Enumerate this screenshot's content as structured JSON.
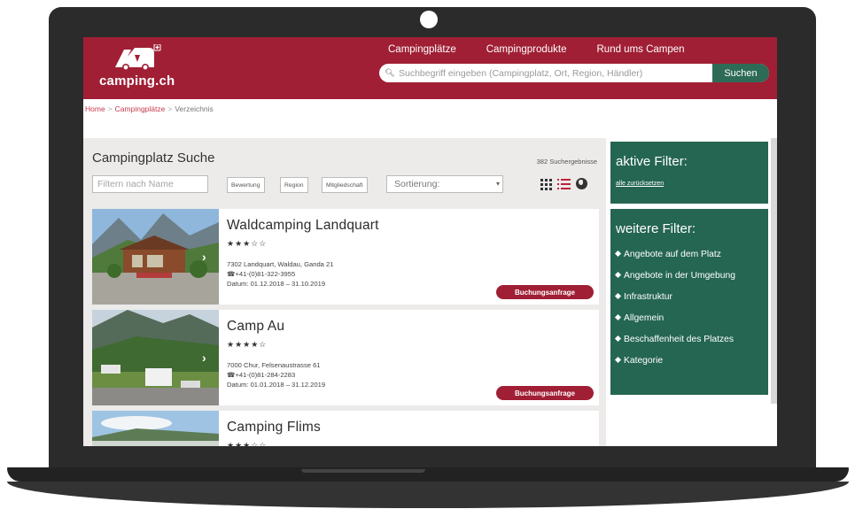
{
  "header": {
    "logo_text": "camping.ch",
    "nav": [
      "Campingplätze",
      "Campingprodukte",
      "Rund ums Campen"
    ],
    "search_placeholder": "Suchbegriff eingeben (Campingplatz, Ort, Region, Händler)",
    "search_button": "Suchen"
  },
  "breadcrumb": [
    "Home",
    "Campingplätze",
    "Verzeichnis"
  ],
  "main": {
    "title": "Campingplatz Suche",
    "result_count": "382 Suchergebnisse",
    "filter_placeholder": "Filtern nach Name",
    "filter_buttons": [
      "Bewertung",
      "Region",
      "Mitgliedschaft"
    ],
    "sort_label": "Sortierung:"
  },
  "results": [
    {
      "name": "Waldcamping Landquart",
      "stars": "★★★☆☆",
      "address": "7302 Landquart, Waldau, Ganda 21",
      "phone": "☎+41-(0)81-322-3955",
      "date": "Datum: 01.12.2018 – 31.10.2019",
      "booking": "Buchungsanfrage"
    },
    {
      "name": "Camp Au",
      "stars": "★★★★☆",
      "address": "7000 Chur, Felsenaustrasse 61",
      "phone": "☎+41-(0)81-284-2283",
      "date": "Datum: 01.01.2018 – 31.12.2019",
      "booking": "Buchungsanfrage"
    },
    {
      "name": "Camping Flims",
      "stars": "★★★☆☆",
      "address": "",
      "phone": "",
      "date": "",
      "booking": ""
    }
  ],
  "sidebar": {
    "active_title": "aktive Filter:",
    "reset": "alle zurücksetzen",
    "more_title": "weitere Filter:",
    "filters": [
      "Angebote auf dem Platz",
      "Angebote in der Umgebung",
      "Infrastruktur",
      "Allgemein",
      "Beschaffenheit des Platzes",
      "Kategorie"
    ]
  },
  "colors": {
    "brand_red": "#a01f35",
    "brand_green": "#256653"
  }
}
